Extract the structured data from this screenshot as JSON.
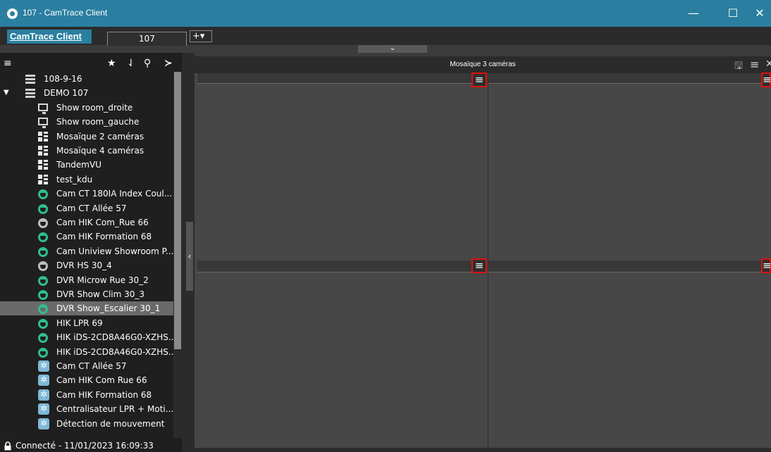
{
  "window": {
    "title": "107 - CamTrace Client",
    "minimize": "—",
    "maximize": "☐",
    "close": "✕",
    "bar_color": "#2a7fa0"
  },
  "tabs": {
    "app_label": "CamTrace Client",
    "site_tab": "107",
    "add_tab": "+▾",
    "collapse_glyph": "⌄"
  },
  "sidebar": {
    "toolbar": [
      "menu-icon",
      "star-icon",
      "sort-icon",
      "search-icon",
      "terminal-icon"
    ],
    "tree": [
      {
        "label": "108-9-16",
        "icon": "server-icon"
      },
      {
        "label": "DEMO 107",
        "icon": "server-icon",
        "expanded": true
      },
      {
        "label": "Show room_droite",
        "icon": "monitor-icon"
      },
      {
        "label": "Show room_gauche",
        "icon": "monitor-icon"
      },
      {
        "label": "Mosaïque 2 caméras",
        "icon": "mosaic-icon"
      },
      {
        "label": "Mosaïque 4 caméras",
        "icon": "mosaic-icon"
      },
      {
        "label": "TandemVU",
        "icon": "mosaic-icon"
      },
      {
        "label": "test_kdu",
        "icon": "mosaic-icon"
      },
      {
        "label": "Cam CT 180IA Index Coul...",
        "icon": "camera-icon"
      },
      {
        "label": "Cam CT Allée 57",
        "icon": "camera-icon"
      },
      {
        "label": "Cam HIK Com_Rue 66",
        "icon": "camera-icon",
        "status": "gray"
      },
      {
        "label": "Cam HIK Formation 68",
        "icon": "camera-icon"
      },
      {
        "label": "Cam Uniview Showroom P...",
        "icon": "camera-icon"
      },
      {
        "label": "DVR HS 30_4",
        "icon": "camera-icon",
        "status": "gray"
      },
      {
        "label": "DVR Microw Rue 30_2",
        "icon": "camera-icon"
      },
      {
        "label": "DVR Show Clim 30_3",
        "icon": "camera-icon"
      },
      {
        "label": "DVR Show_Escalier 30_1",
        "icon": "camera-icon",
        "selected": true
      },
      {
        "label": "HIK LPR 69",
        "icon": "camera-icon"
      },
      {
        "label": "HIK iDS-2CD8A46G0-XZHS...",
        "icon": "camera-icon"
      },
      {
        "label": "HIK iDS-2CD8A46G0-XZHS...",
        "icon": "camera-icon"
      },
      {
        "label": "Cam CT Allée 57",
        "icon": "analytics-icon"
      },
      {
        "label": "Cam HIK Com Rue 66",
        "icon": "analytics-icon"
      },
      {
        "label": "Cam HIK Formation 68",
        "icon": "analytics-icon"
      },
      {
        "label": "Centralisateur LPR + Moti...",
        "icon": "analytics-icon"
      },
      {
        "label": "Détection de mouvement",
        "icon": "analytics-icon"
      }
    ],
    "status": "Connecté - 11/01/2023 16:09:33",
    "collapse_glyph": "‹"
  },
  "main": {
    "title": "Mosaïque 3 caméras",
    "menu_glyph": "≡",
    "save_glyph": "🖫",
    "close_glyph": "✕"
  },
  "colors": {
    "accent": "#2a7fa0",
    "camera_online": "#2fbf8a",
    "camera_offline": "#bfbfbf",
    "highlight_box": "#e01010"
  }
}
